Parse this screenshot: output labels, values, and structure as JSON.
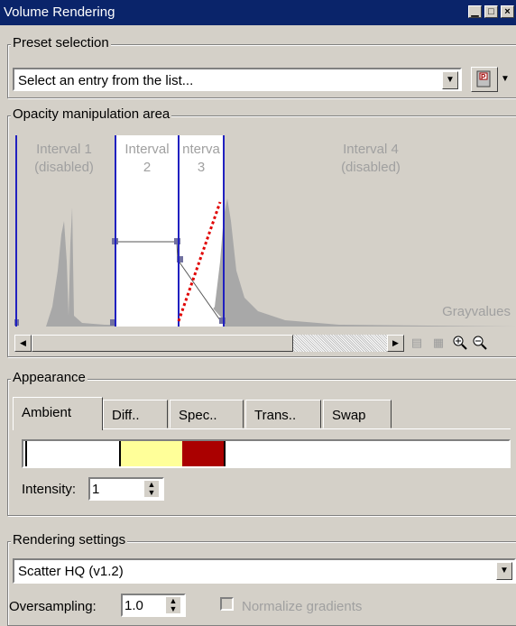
{
  "window": {
    "title": "Volume Rendering",
    "controls": [
      "minimize",
      "maximize",
      "close"
    ]
  },
  "preset": {
    "legend": "Preset selection",
    "combo_value": "Select an entry from the list..."
  },
  "opacity": {
    "legend": "Opacity manipulation area",
    "intervals": [
      {
        "line1": "Interval 1",
        "line2": "(disabled)"
      },
      {
        "line1": "Interval",
        "line2": "2"
      },
      {
        "line1": "nterva",
        "line2": "3"
      },
      {
        "line1": "Interval 4",
        "line2": "(disabled)"
      }
    ],
    "axis_label": "Grayvalues"
  },
  "appearance": {
    "legend": "Appearance",
    "tabs": [
      {
        "label": "Ambient",
        "active": true
      },
      {
        "label": "Diff.."
      },
      {
        "label": "Spec.."
      },
      {
        "label": "Trans.."
      },
      {
        "label": "Swap"
      }
    ],
    "colors": {
      "yellow": "#ffff99",
      "red": "#aa0000"
    },
    "intensity_label": "Intensity:",
    "intensity_value": "1"
  },
  "rendering": {
    "legend": "Rendering settings",
    "mode_value": "Scatter HQ (v1.2)",
    "oversampling_label": "Oversampling:",
    "oversampling_value": "1.0",
    "normalize_label": "Normalize gradients",
    "normalize_checked": false
  }
}
